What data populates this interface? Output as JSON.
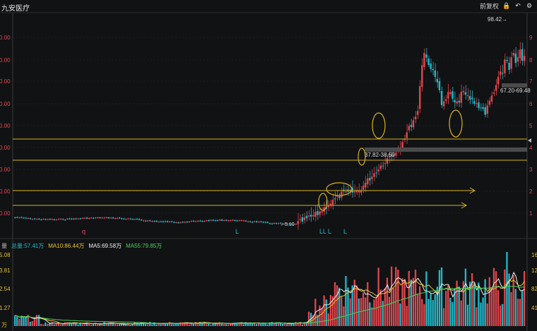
{
  "app": {
    "stock_name": "九安医疗",
    "adjust_label": "前复权",
    "icons": [
      "lock-icon",
      "undo-icon",
      "settings-icon"
    ]
  },
  "colors": {
    "background": "#111214",
    "up": "#e0454d",
    "down": "#22b8c8",
    "guide_line": "#d6b21a",
    "ellipse": "#d6b21a",
    "ma5": "#f0f0f0",
    "ma10": "#e8c233",
    "ma55": "#45d45b"
  },
  "chart_data": [
    {
      "type": "candlestick",
      "price_axis_left_ticks": [
        "0.00",
        "0.00",
        "0.00",
        "0.00",
        "0.00",
        "0.00",
        "0.00",
        "0.00",
        "0.00",
        "0.00"
      ],
      "price_axis_right_ticks": [
        "9",
        "8",
        "7",
        "6",
        "5",
        "4",
        "3",
        "2",
        "1"
      ],
      "annotations": {
        "peak_label": "98.42→",
        "low_label": "←5.10",
        "range_label_1": "37.82-38.60",
        "range_label_2": "67.20-69.48"
      },
      "signal_markers": [
        "q",
        "L",
        "LL",
        "L",
        "L"
      ],
      "guide_levels": [
        44,
        35,
        21,
        15
      ],
      "highlight_zones": 5
    },
    {
      "type": "bar",
      "panel": "volume",
      "panel_label": "量",
      "unit_label": "万",
      "left_ticks": [
        "5.08",
        "3.81",
        "2.54",
        "1.27"
      ],
      "right_ticks": [
        "16",
        "12",
        "82",
        "41"
      ],
      "legend": {
        "total": "总量:57.41万",
        "ma10": "MA10:86.44万",
        "ma5": "MA5:69.58万",
        "ma55": "MA55:79.85万"
      }
    }
  ]
}
